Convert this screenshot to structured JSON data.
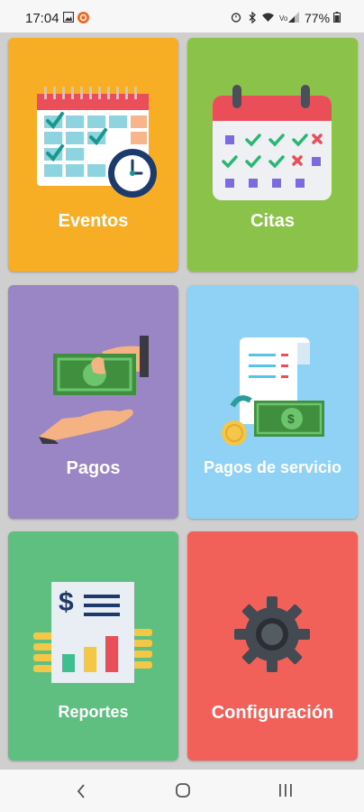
{
  "status_bar": {
    "time": "17:04",
    "battery": "77%",
    "icons": [
      "gallery-icon",
      "ubuntu-notification-icon",
      "alarm-icon",
      "bluetooth-icon",
      "wifi-icon",
      "signal-icon",
      "battery-icon"
    ]
  },
  "tiles": [
    {
      "label": "Eventos",
      "color": "#f7ad24",
      "icon": "calendar-clock-icon"
    },
    {
      "label": "Citas",
      "color": "#8bc34a",
      "icon": "calendar-checkmarks-icon"
    },
    {
      "label": "Pagos",
      "color": "#9a86c4",
      "icon": "hand-money-icon"
    },
    {
      "label": "Pagos de servicio",
      "color": "#90d2f6",
      "icon": "bill-receipt-icon"
    },
    {
      "label": "Reportes",
      "color": "#5fbf80",
      "icon": "report-chart-icon"
    },
    {
      "label": "Configuración",
      "color": "#f2605a",
      "icon": "gear-icon"
    }
  ],
  "nav": {
    "buttons": [
      "back-icon",
      "home-icon",
      "recents-icon"
    ]
  }
}
